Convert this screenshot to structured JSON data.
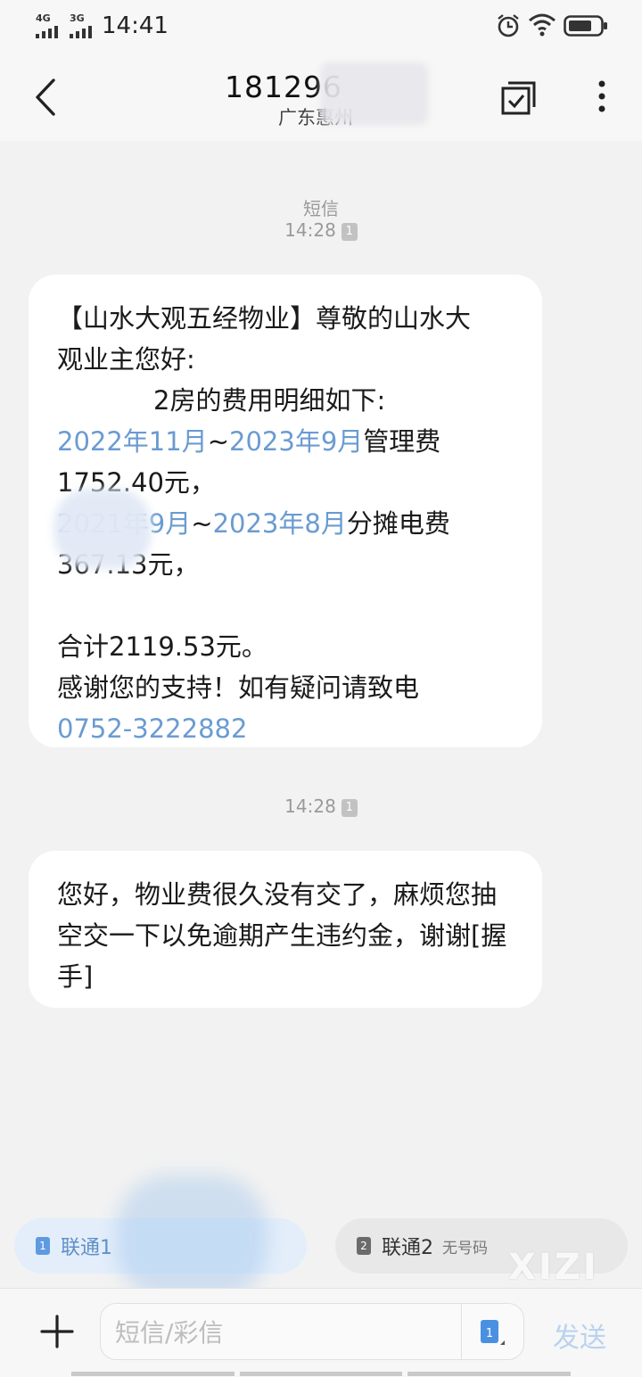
{
  "status_bar": {
    "network1": "4G",
    "network2": "3G",
    "time": "14:41"
  },
  "header": {
    "contact_number": "181296",
    "contact_region": "广东惠州"
  },
  "conversation": {
    "channel_label": "短信",
    "messages": [
      {
        "time": "14:28",
        "sim": "1",
        "lines": [
          "【山水大观五经物业】尊敬的山水大",
          "观业主您好:",
          "2房的费用明细如下:"
        ],
        "fee1_date_start": "2022年11月",
        "fee1_sep": "~",
        "fee1_date_end": "2023年9月",
        "fee1_label": "管理费",
        "fee1_amount": "1752.40元，",
        "fee2_date_start": "2021年9月",
        "fee2_sep": "~",
        "fee2_date_end": "2023年8月",
        "fee2_label": "分摊电费",
        "fee2_amount": "367.13元，",
        "total": "合计2119.53元。",
        "thanks": "感谢您的支持！如有疑问请致电",
        "phone": "0752-3222882"
      },
      {
        "time": "14:28",
        "sim": "1",
        "text": "您好，物业费很久没有交了，麻烦您抽空交一下以免逾期产生违约金，谢谢[握手]"
      }
    ]
  },
  "sim_selector": {
    "sim1": {
      "badge": "1",
      "label": "联通1"
    },
    "sim2": {
      "badge": "2",
      "label": "联通2",
      "note": "无号码"
    }
  },
  "watermark": "XIZI",
  "input": {
    "placeholder": "短信/彩信",
    "sim_badge": "1",
    "send_label": "发送"
  },
  "colors": {
    "link": "#6a9bd1",
    "sim1_bg": "#e4eefa",
    "sim2_bg": "#e8e8e8",
    "send_disabled": "#b9d3ef"
  }
}
